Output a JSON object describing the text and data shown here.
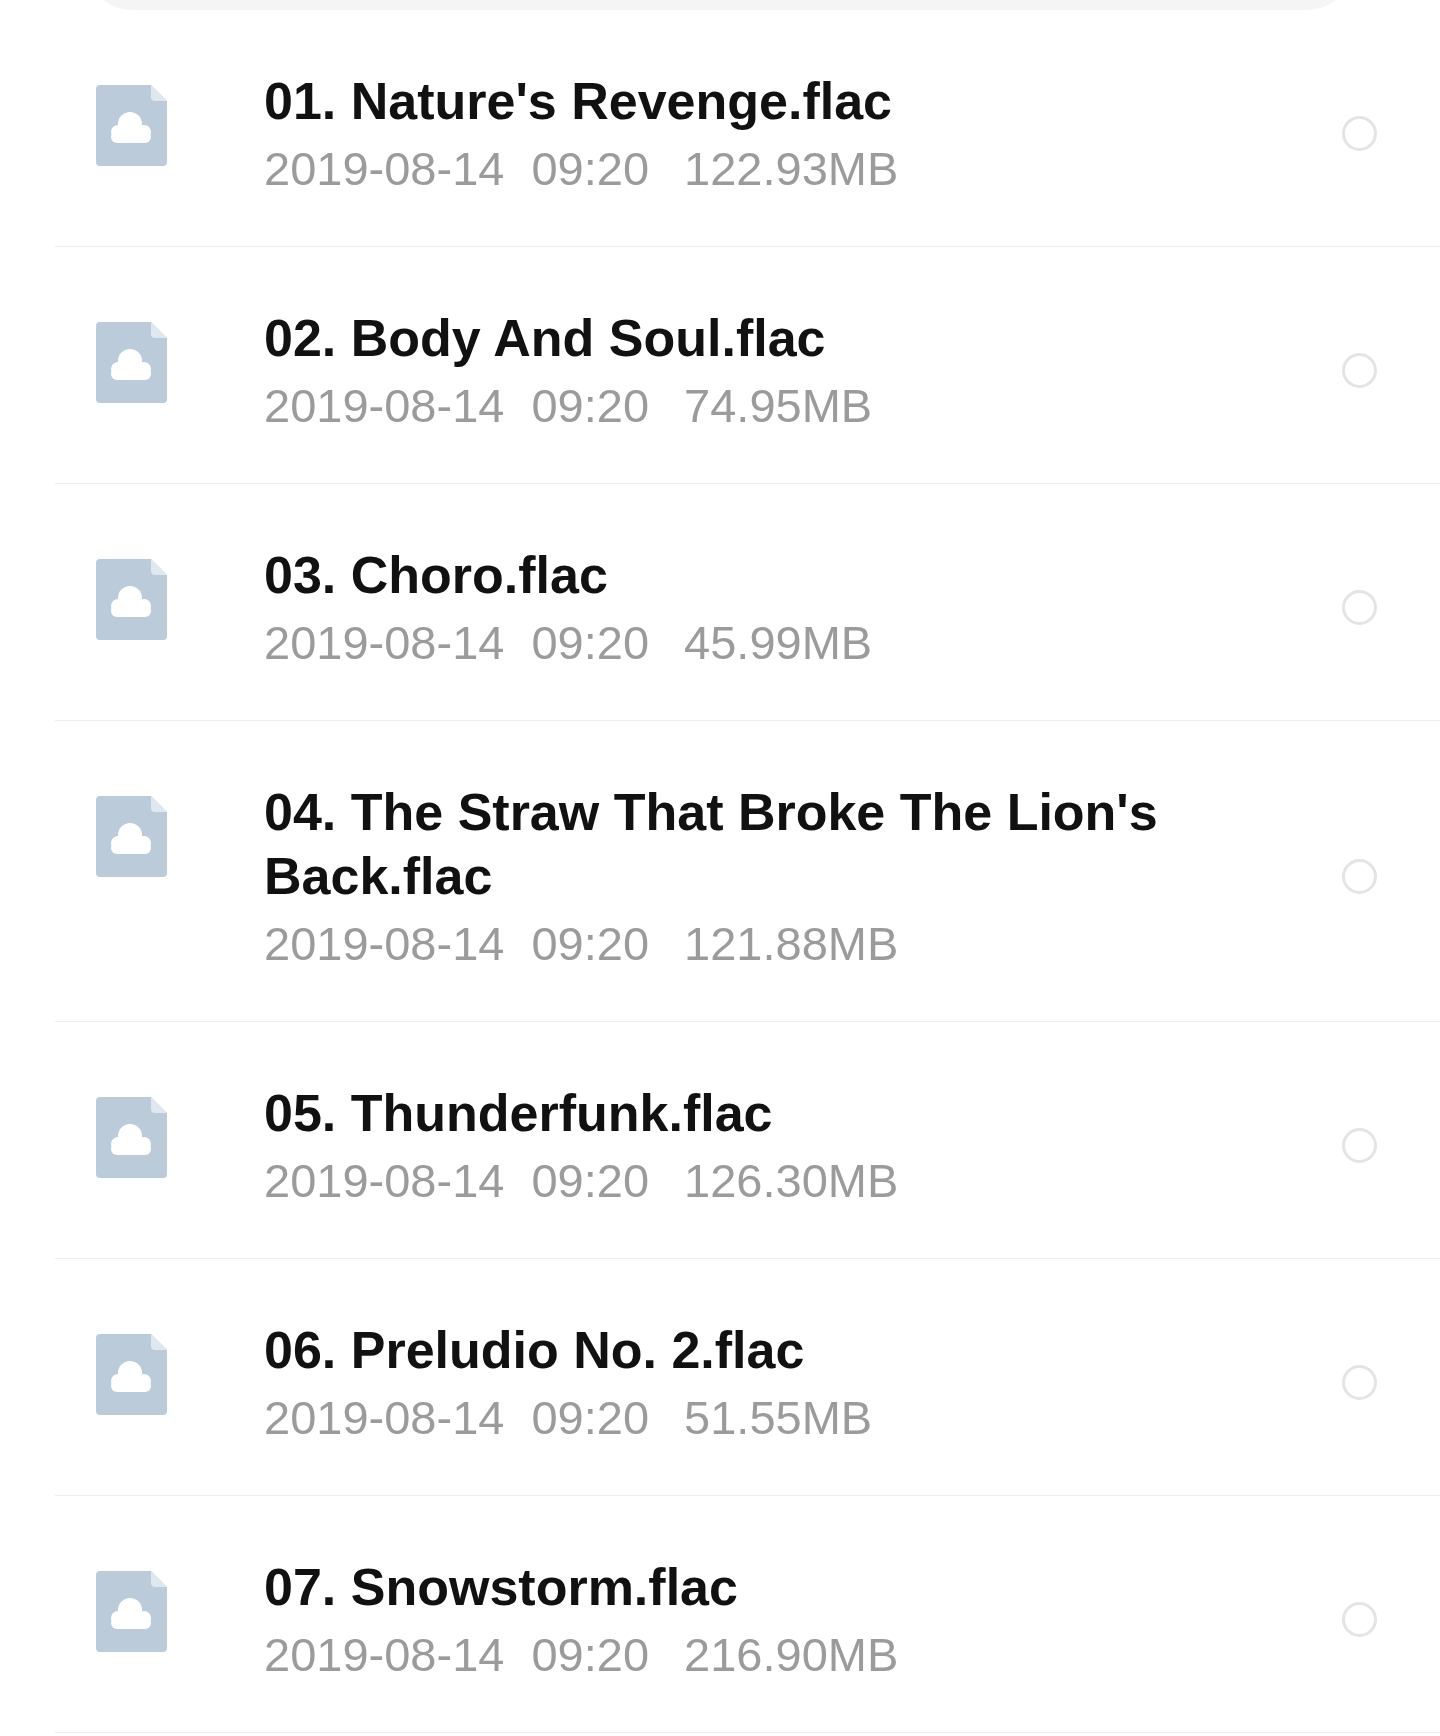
{
  "files": [
    {
      "name": "01. Nature's Revenge.flac",
      "date": "2019-08-14",
      "time": "09:20",
      "size": "122.93MB",
      "selected": false
    },
    {
      "name": "02. Body And Soul.flac",
      "date": "2019-08-14",
      "time": "09:20",
      "size": "74.95MB",
      "selected": false
    },
    {
      "name": "03. Choro.flac",
      "date": "2019-08-14",
      "time": "09:20",
      "size": "45.99MB",
      "selected": false
    },
    {
      "name": "04. The Straw That Broke The Lion's Back.flac",
      "date": "2019-08-14",
      "time": "09:20",
      "size": "121.88MB",
      "selected": false
    },
    {
      "name": "05. Thunderfunk.flac",
      "date": "2019-08-14",
      "time": "09:20",
      "size": "126.30MB",
      "selected": false
    },
    {
      "name": "06. Preludio No. 2.flac",
      "date": "2019-08-14",
      "time": "09:20",
      "size": "51.55MB",
      "selected": false
    },
    {
      "name": "07. Snowstorm.flac",
      "date": "2019-08-14",
      "time": "09:20",
      "size": "216.90MB",
      "selected": false
    }
  ]
}
